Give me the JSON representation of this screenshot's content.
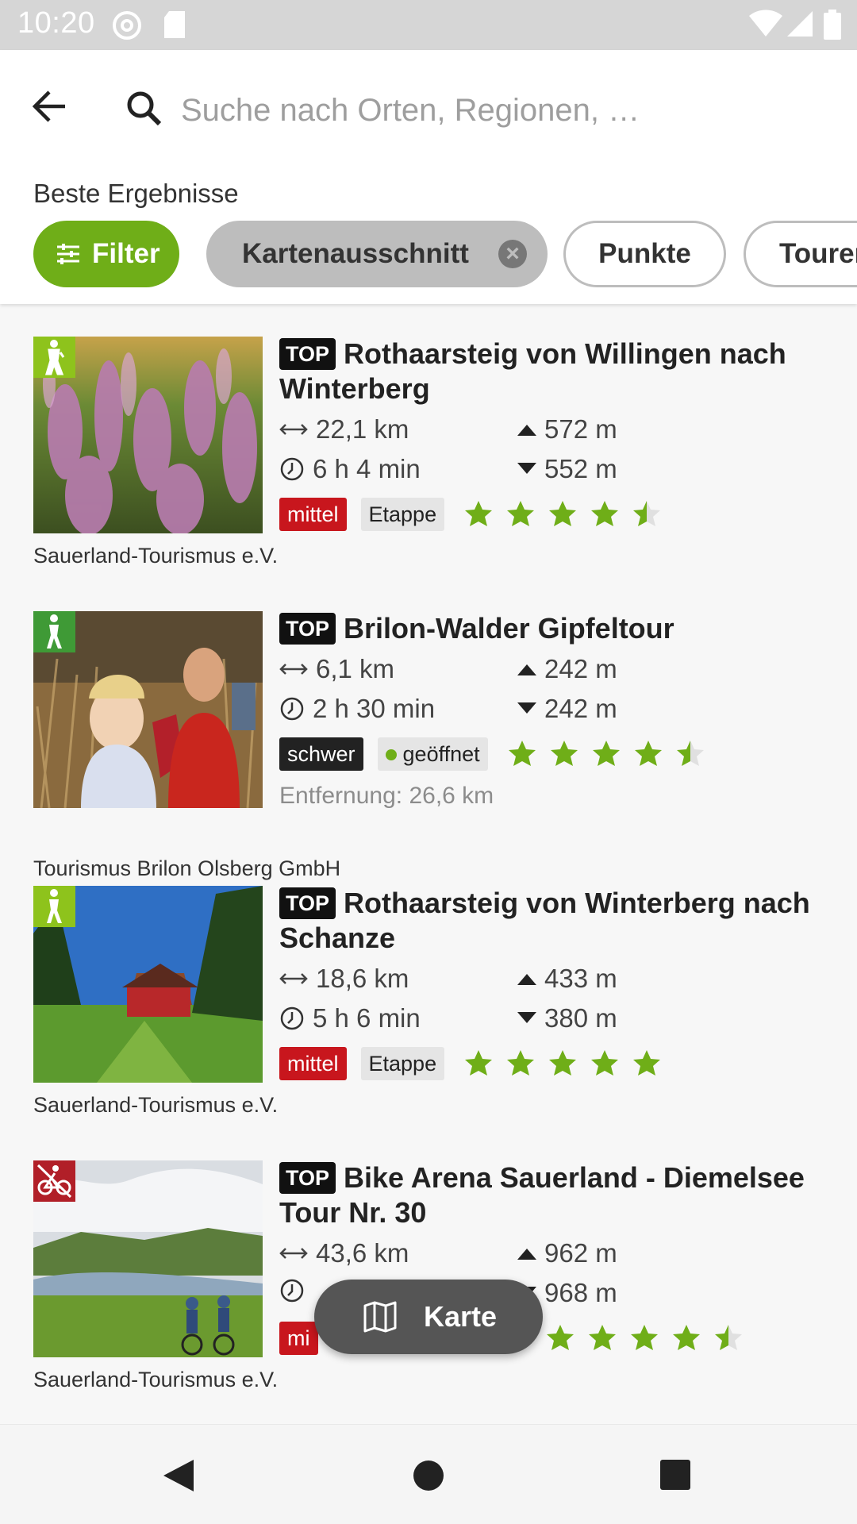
{
  "status": {
    "time": "10:20"
  },
  "search": {
    "placeholder": "Suche nach Orten, Regionen, …"
  },
  "section_title": "Beste Ergebnisse",
  "chips": {
    "filter": "Filter",
    "map_section": "Kartenausschnitt",
    "points": "Punkte",
    "tours": "Touren"
  },
  "colors": {
    "accent": "#6fae18",
    "medium": "#c8161d",
    "hard": "#222222"
  },
  "items": [
    {
      "top": "TOP",
      "title": "Rothaarsteig von Willingen nach Winterberg",
      "distance": "22,1 km",
      "duration": "6 h 4 min",
      "ascent": "572 m",
      "descent": "552 m",
      "difficulty": "mittel",
      "tag": "Etappe",
      "rating": 4.5,
      "source": "Sauerland-Tourismus e.V.",
      "category_icon": "hiking-icon"
    },
    {
      "top": "TOP",
      "title": "Brilon-Walder Gipfeltour",
      "distance": "6,1 km",
      "duration": "2 h 30 min",
      "ascent": "242 m",
      "descent": "242 m",
      "difficulty": "schwer",
      "tag": "geöffnet",
      "rating": 4.5,
      "distance_from": "Entfernung: 26,6 km",
      "source": "Tourismus Brilon Olsberg GmbH",
      "category_icon": "hiking-icon"
    },
    {
      "top": "TOP",
      "title": "Rothaarsteig von Winterberg nach Schanze",
      "distance": "18,6 km",
      "duration": "5 h 6 min",
      "ascent": "433 m",
      "descent": "380 m",
      "difficulty": "mittel",
      "tag": "Etappe",
      "rating": 5,
      "source": "Sauerland-Tourismus e.V.",
      "category_icon": "hiking-icon"
    },
    {
      "top": "TOP",
      "title": "Bike Arena Sauerland - Diemelsee Tour Nr. 30",
      "distance": "43,6 km",
      "duration": "",
      "ascent": "962 m",
      "descent": "968 m",
      "difficulty": "mittel",
      "difficulty_visible": "mi",
      "tag": "",
      "rating": 4.5,
      "source": "Sauerland-Tourismus e.V.",
      "category_icon": "mountainbike-icon"
    }
  ],
  "fab": {
    "label": "Karte"
  }
}
